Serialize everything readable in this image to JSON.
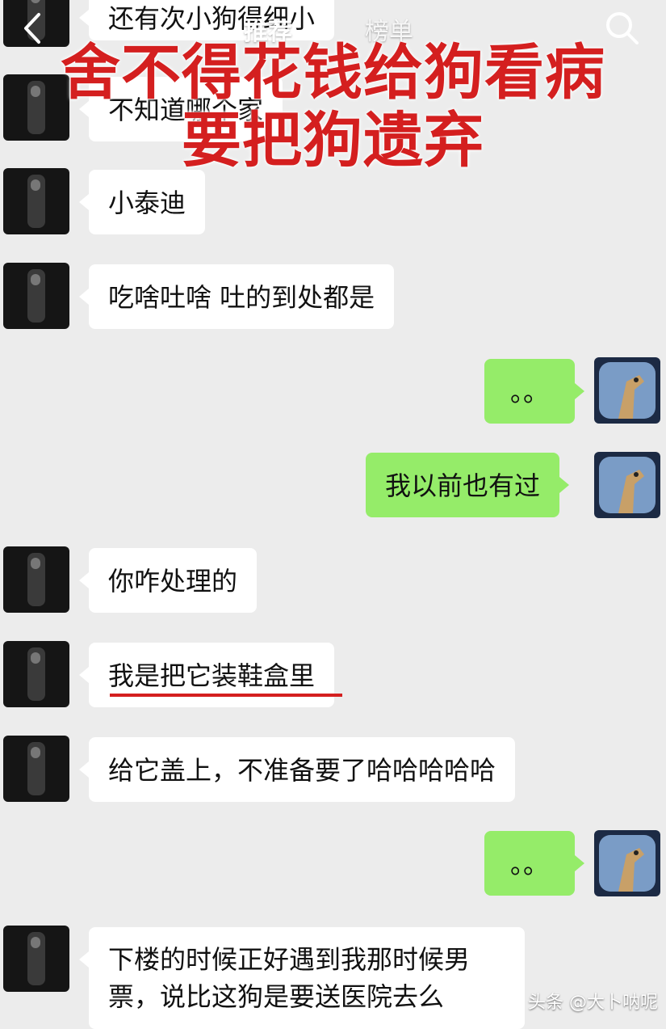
{
  "header": {
    "tab_recommend": "推荐",
    "tab_ranking": "榜单"
  },
  "overlay": {
    "line1": "舍不得花钱给狗看病",
    "line2": "要把狗遗弃"
  },
  "messages": {
    "m0": "还有次小狗得细小",
    "m1": "不知道哪个家",
    "m2": "小泰迪",
    "m3": "吃啥吐啥 吐的到处都是",
    "m4": "。。",
    "m5": "我以前也有过",
    "m6": "你咋处理的",
    "m7": "我是把它装鞋盒里",
    "m8": "给它盖上，不准备要了哈哈哈哈哈",
    "m9": "。。",
    "m10a": "下楼的时候正好遇到我那时候男",
    "m10b": "票，说比这狗是要送医院去么"
  },
  "watermark": "头条 @大卜呐呢",
  "colors": {
    "overlay_red": "#d41f1f",
    "sent_bubble": "#95ec69",
    "received_bubble": "#ffffff"
  },
  "icons": {
    "back": "chevron-left-icon",
    "search": "search-icon"
  }
}
